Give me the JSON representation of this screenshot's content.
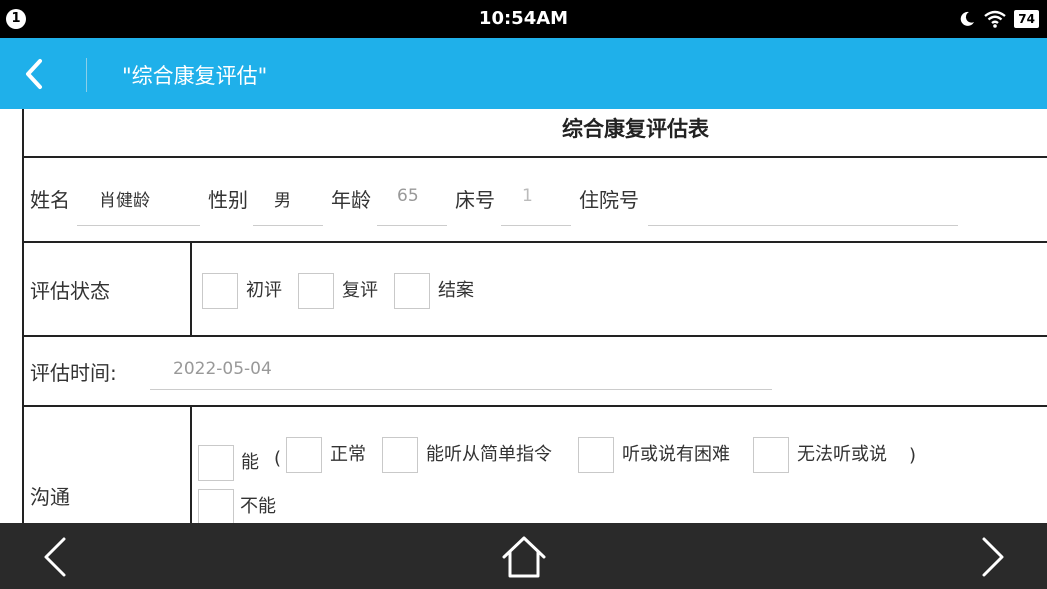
{
  "status_bar": {
    "notification_count": "1",
    "time": "10:54AM",
    "battery_level": "74",
    "icons": [
      "moon-icon",
      "wifi-icon",
      "battery-icon"
    ]
  },
  "app_bar": {
    "title": "\"综合康复评估\"",
    "back_icon": "chevron-left-icon",
    "background_color": "#1fb0ea"
  },
  "form": {
    "title": "综合康复评估表",
    "patient": {
      "name_label": "姓名",
      "name_value": "肖健龄",
      "gender_label": "性别",
      "gender_value": "男",
      "age_label": "年龄",
      "age_value": "65",
      "bed_label": "床号",
      "bed_value": "1",
      "admission_label": "住院号",
      "admission_value": ""
    },
    "status": {
      "label": "评估状态",
      "options": [
        "初评",
        "复评",
        "结案"
      ]
    },
    "time": {
      "label": "评估时间:",
      "value": "2022-05-04"
    },
    "communication": {
      "label": "沟通",
      "can_label": "能",
      "open_paren": "(",
      "sub_options": [
        "正常",
        "能听从简单指令",
        "听或说有困难",
        "无法听或说"
      ],
      "close_paren": ")",
      "cannot_label": "不能"
    }
  },
  "nav_bar": {
    "icons": [
      "back-arrow-icon",
      "home-icon",
      "forward-arrow-icon"
    ]
  }
}
